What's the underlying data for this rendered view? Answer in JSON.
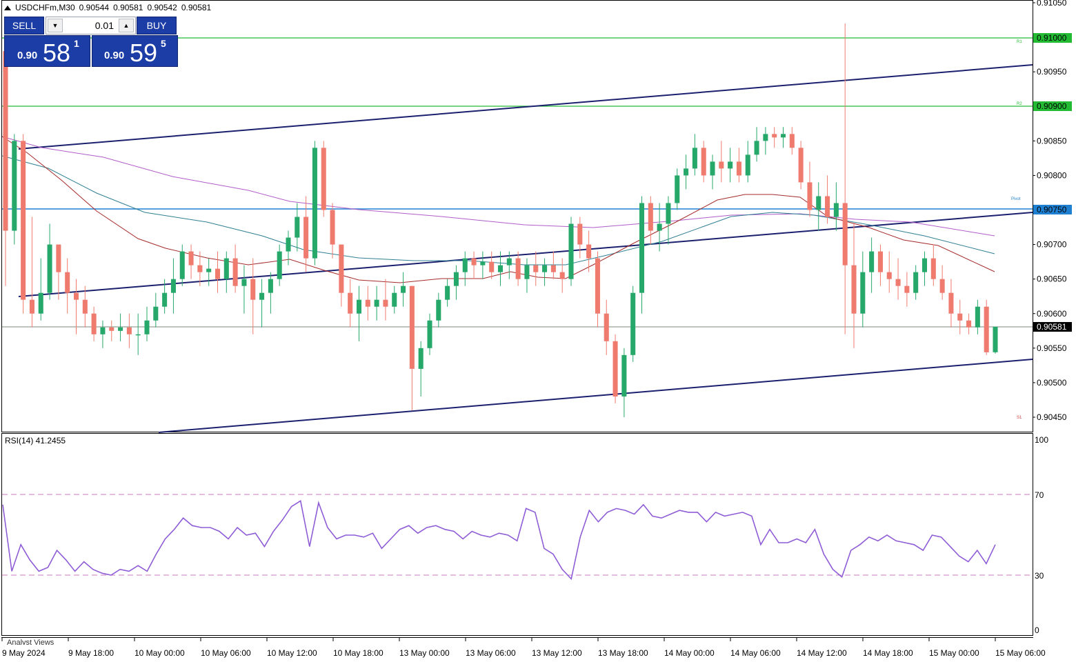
{
  "header": {
    "symbol": "USDCHFm,M30",
    "open": "0.90544",
    "high": "0.90581",
    "low": "0.90542",
    "close": "0.90581"
  },
  "trade_panel": {
    "sell_label": "SELL",
    "buy_label": "BUY",
    "lot_value": "0.01",
    "sell_price_small": "0.90",
    "sell_price_big": "58",
    "sell_price_sup": "1",
    "buy_price_small": "0.90",
    "buy_price_big": "59",
    "buy_price_sup": "5",
    "button_color": "#1d3da6"
  },
  "price_axis": {
    "ticks": [
      "0.91050",
      "0.91000",
      "0.90950",
      "0.90900",
      "0.90850",
      "0.90800",
      "0.90750",
      "0.90700",
      "0.90650",
      "0.90600",
      "0.90550",
      "0.90500",
      "0.90450"
    ],
    "current_price_label": "0.90581",
    "r1_label": "0.91000",
    "r2_label": "0.90900",
    "pivot_label": "0.90750"
  },
  "levels": {
    "r1_tag": "R1",
    "r2_tag": "R2",
    "pivot_tag": "Pivot",
    "s1_tag": "S1",
    "r_color": "#22bb33",
    "pivot_color": "#1f7fd0",
    "s_color": "#d23a3a"
  },
  "rsi": {
    "label": "RSI(14) 41.2455",
    "ticks": [
      "100",
      "70",
      "30",
      "0"
    ],
    "line_color": "#8e5cd6"
  },
  "time_axis": {
    "labels": [
      "9 May 2024",
      "9 May 18:00",
      "10 May 00:00",
      "10 May 06:00",
      "10 May 12:00",
      "10 May 18:00",
      "13 May 00:00",
      "13 May 06:00",
      "13 May 12:00",
      "13 May 18:00",
      "14 May 00:00",
      "14 May 06:00",
      "14 May 12:00",
      "14 May 18:00",
      "15 May 00:00",
      "15 May 06:00"
    ]
  },
  "footer": {
    "analyst_views": "Analyst Views"
  },
  "colors": {
    "bull": "#26a86a",
    "bear": "#ef7a6e",
    "ma_fast": "#a52a2a",
    "ma_mid": "#2e7f93",
    "ma_slow": "#b05cc8",
    "channel": "#1a1f6e"
  },
  "chart_data": {
    "type": "candlestick",
    "title": "USDCHFm,M30",
    "ylim": [
      0.9044,
      0.9105
    ],
    "candles": [
      [
        0.9098,
        0.9099,
        0.9064,
        0.9072
      ],
      [
        0.9072,
        0.9086,
        0.907,
        0.9085
      ],
      [
        0.9085,
        0.9086,
        0.906,
        0.9062
      ],
      [
        0.9062,
        0.9074,
        0.9058,
        0.906
      ],
      [
        0.906,
        0.9068,
        0.9059,
        0.9063
      ],
      [
        0.9063,
        0.9073,
        0.9062,
        0.907
      ],
      [
        0.907,
        0.907,
        0.9062,
        0.9066
      ],
      [
        0.9066,
        0.9068,
        0.906,
        0.9063
      ],
      [
        0.9063,
        0.9065,
        0.9057,
        0.9062
      ],
      [
        0.9062,
        0.9064,
        0.9058,
        0.906
      ],
      [
        0.906,
        0.9061,
        0.9056,
        0.9057
      ],
      [
        0.9057,
        0.9059,
        0.9055,
        0.9058
      ],
      [
        0.9058,
        0.9059,
        0.9056,
        0.90575
      ],
      [
        0.90575,
        0.906,
        0.9056,
        0.9058
      ],
      [
        0.9058,
        0.906,
        0.9055,
        0.9057
      ],
      [
        0.9057,
        0.906,
        0.9054,
        0.9057
      ],
      [
        0.9057,
        0.9061,
        0.9056,
        0.9059
      ],
      [
        0.9059,
        0.9063,
        0.9058,
        0.9061
      ],
      [
        0.9061,
        0.9065,
        0.906,
        0.9063
      ],
      [
        0.9063,
        0.9068,
        0.906,
        0.9065
      ],
      [
        0.9065,
        0.907,
        0.9064,
        0.9069
      ],
      [
        0.9069,
        0.907,
        0.9065,
        0.9067
      ],
      [
        0.9067,
        0.9069,
        0.9064,
        0.9066
      ],
      [
        0.9066,
        0.9068,
        0.9064,
        0.90665
      ],
      [
        0.90665,
        0.9069,
        0.9063,
        0.9065
      ],
      [
        0.9065,
        0.9069,
        0.9063,
        0.9068
      ],
      [
        0.9068,
        0.907,
        0.9063,
        0.9064
      ],
      [
        0.9064,
        0.9067,
        0.906,
        0.9065
      ],
      [
        0.9065,
        0.9068,
        0.9057,
        0.9062
      ],
      [
        0.9062,
        0.9065,
        0.9058,
        0.9063
      ],
      [
        0.9063,
        0.9066,
        0.906,
        0.9065
      ],
      [
        0.9065,
        0.907,
        0.9064,
        0.9069
      ],
      [
        0.9069,
        0.9072,
        0.9067,
        0.9071
      ],
      [
        0.9071,
        0.9076,
        0.9069,
        0.9074
      ],
      [
        0.9074,
        0.9077,
        0.9066,
        0.9068
      ],
      [
        0.9068,
        0.9085,
        0.9067,
        0.9084
      ],
      [
        0.9084,
        0.9085,
        0.9074,
        0.9075
      ],
      [
        0.9075,
        0.9076,
        0.9068,
        0.907
      ],
      [
        0.907,
        0.907,
        0.9061,
        0.9063
      ],
      [
        0.9063,
        0.9065,
        0.9058,
        0.906
      ],
      [
        0.906,
        0.9064,
        0.9056,
        0.9062
      ],
      [
        0.9062,
        0.9064,
        0.9059,
        0.9061
      ],
      [
        0.9061,
        0.9064,
        0.9059,
        0.9062
      ],
      [
        0.9062,
        0.9065,
        0.9059,
        0.9061
      ],
      [
        0.9061,
        0.9064,
        0.906,
        0.9063
      ],
      [
        0.9063,
        0.9066,
        0.9061,
        0.9064
      ],
      [
        0.9064,
        0.9064,
        0.9046,
        0.9052
      ],
      [
        0.9052,
        0.9056,
        0.9048,
        0.9055
      ],
      [
        0.9055,
        0.906,
        0.9054,
        0.9059
      ],
      [
        0.9059,
        0.9063,
        0.9058,
        0.9062
      ],
      [
        0.9062,
        0.9065,
        0.9061,
        0.9064
      ],
      [
        0.9064,
        0.9067,
        0.9062,
        0.9066
      ],
      [
        0.9066,
        0.9069,
        0.9064,
        0.9068
      ],
      [
        0.9068,
        0.9069,
        0.9065,
        0.9067
      ],
      [
        0.9067,
        0.9069,
        0.9065,
        0.90675
      ],
      [
        0.90675,
        0.9069,
        0.9065,
        0.9066
      ],
      [
        0.9066,
        0.9069,
        0.9064,
        0.9067
      ],
      [
        0.9067,
        0.9069,
        0.9065,
        0.9068
      ],
      [
        0.9068,
        0.9069,
        0.9064,
        0.9065
      ],
      [
        0.9065,
        0.9068,
        0.9063,
        0.9067
      ],
      [
        0.9067,
        0.9069,
        0.9064,
        0.9066
      ],
      [
        0.9066,
        0.9068,
        0.9064,
        0.9067
      ],
      [
        0.9067,
        0.9069,
        0.9065,
        0.9066
      ],
      [
        0.9066,
        0.9068,
        0.9063,
        0.9065
      ],
      [
        0.9065,
        0.9074,
        0.9064,
        0.9073
      ],
      [
        0.9073,
        0.9074,
        0.9068,
        0.907
      ],
      [
        0.907,
        0.9072,
        0.9066,
        0.9068
      ],
      [
        0.9068,
        0.9069,
        0.9058,
        0.906
      ],
      [
        0.906,
        0.9062,
        0.9054,
        0.9056
      ],
      [
        0.9056,
        0.9057,
        0.9047,
        0.9048
      ],
      [
        0.9048,
        0.9055,
        0.9045,
        0.9054
      ],
      [
        0.9054,
        0.9064,
        0.9053,
        0.9063
      ],
      [
        0.9063,
        0.9077,
        0.906,
        0.9076
      ],
      [
        0.9076,
        0.9077,
        0.907,
        0.9072
      ],
      [
        0.9072,
        0.9076,
        0.9069,
        0.9073
      ],
      [
        0.9073,
        0.9077,
        0.907,
        0.9076
      ],
      [
        0.9076,
        0.9081,
        0.9075,
        0.908
      ],
      [
        0.908,
        0.9083,
        0.9078,
        0.9081
      ],
      [
        0.9081,
        0.9086,
        0.908,
        0.9084
      ],
      [
        0.9084,
        0.9085,
        0.9079,
        0.908
      ],
      [
        0.908,
        0.9083,
        0.9078,
        0.9082
      ],
      [
        0.9082,
        0.9085,
        0.9079,
        0.9081
      ],
      [
        0.9081,
        0.9084,
        0.9079,
        0.9082
      ],
      [
        0.9082,
        0.9084,
        0.9079,
        0.908
      ],
      [
        0.908,
        0.9085,
        0.9079,
        0.9083
      ],
      [
        0.9083,
        0.9087,
        0.9082,
        0.9085
      ],
      [
        0.9085,
        0.9087,
        0.9083,
        0.9086
      ],
      [
        0.9086,
        0.9087,
        0.9084,
        0.90855
      ],
      [
        0.90855,
        0.9087,
        0.9084,
        0.9086
      ],
      [
        0.9086,
        0.9087,
        0.9083,
        0.9084
      ],
      [
        0.9084,
        0.9085,
        0.9078,
        0.9079
      ],
      [
        0.9079,
        0.9082,
        0.9074,
        0.9075
      ],
      [
        0.9075,
        0.9079,
        0.9072,
        0.9077
      ],
      [
        0.9077,
        0.908,
        0.9073,
        0.9074
      ],
      [
        0.9074,
        0.9079,
        0.9072,
        0.9076
      ],
      [
        0.9076,
        0.9102,
        0.9057,
        0.9067
      ],
      [
        0.9067,
        0.9073,
        0.9055,
        0.906
      ],
      [
        0.906,
        0.9069,
        0.9058,
        0.9066
      ],
      [
        0.9066,
        0.9071,
        0.9063,
        0.9069
      ],
      [
        0.9069,
        0.907,
        0.9064,
        0.9066
      ],
      [
        0.9066,
        0.9069,
        0.9063,
        0.9065
      ],
      [
        0.9065,
        0.9068,
        0.9062,
        0.9064
      ],
      [
        0.9064,
        0.9066,
        0.9061,
        0.9063
      ],
      [
        0.9063,
        0.9067,
        0.9062,
        0.9066
      ],
      [
        0.9066,
        0.9069,
        0.9064,
        0.9068
      ],
      [
        0.9068,
        0.907,
        0.9064,
        0.9065
      ],
      [
        0.9065,
        0.9067,
        0.9062,
        0.9063
      ],
      [
        0.9063,
        0.9065,
        0.9058,
        0.906
      ],
      [
        0.906,
        0.9062,
        0.9057,
        0.9059
      ],
      [
        0.9059,
        0.906,
        0.9057,
        0.9058
      ],
      [
        0.9058,
        0.9062,
        0.9057,
        0.9061
      ],
      [
        0.9061,
        0.9062,
        0.9054,
        0.90544
      ],
      [
        0.90544,
        0.90581,
        0.90542,
        0.90581
      ]
    ],
    "series": [
      {
        "name": "RSI(14)",
        "values": [
          66,
          31,
          45,
          37,
          31,
          33,
          42,
          37,
          31,
          36,
          32,
          30,
          29,
          32,
          31,
          34,
          31,
          40,
          48,
          53,
          59,
          55,
          54,
          54,
          52,
          48,
          54,
          50,
          51,
          44,
          52,
          58,
          65,
          68,
          44,
          67,
          54,
          48,
          50,
          50,
          49,
          51,
          43,
          48,
          53,
          55,
          51,
          54,
          55,
          53,
          52,
          48,
          52,
          50,
          49,
          51,
          50,
          47,
          64,
          62,
          43,
          40,
          32,
          27,
          49,
          63,
          57,
          62,
          64,
          63,
          61,
          66,
          60,
          59,
          61,
          63,
          62,
          62,
          57,
          62,
          60,
          61,
          62,
          60,
          45,
          53,
          46,
          46,
          48,
          46,
          53,
          40,
          32,
          28,
          42,
          45,
          49,
          47,
          50,
          47,
          46,
          45,
          42,
          50,
          49,
          44,
          39,
          36,
          42,
          35,
          45
        ]
      }
    ],
    "levels": {
      "R1": 0.91,
      "R2": 0.909,
      "Pivot": 0.9075,
      "Current": 0.90581
    },
    "rsi_ylim": [
      0,
      100
    ],
    "rsi_levels": [
      70,
      30
    ],
    "grid": false
  }
}
